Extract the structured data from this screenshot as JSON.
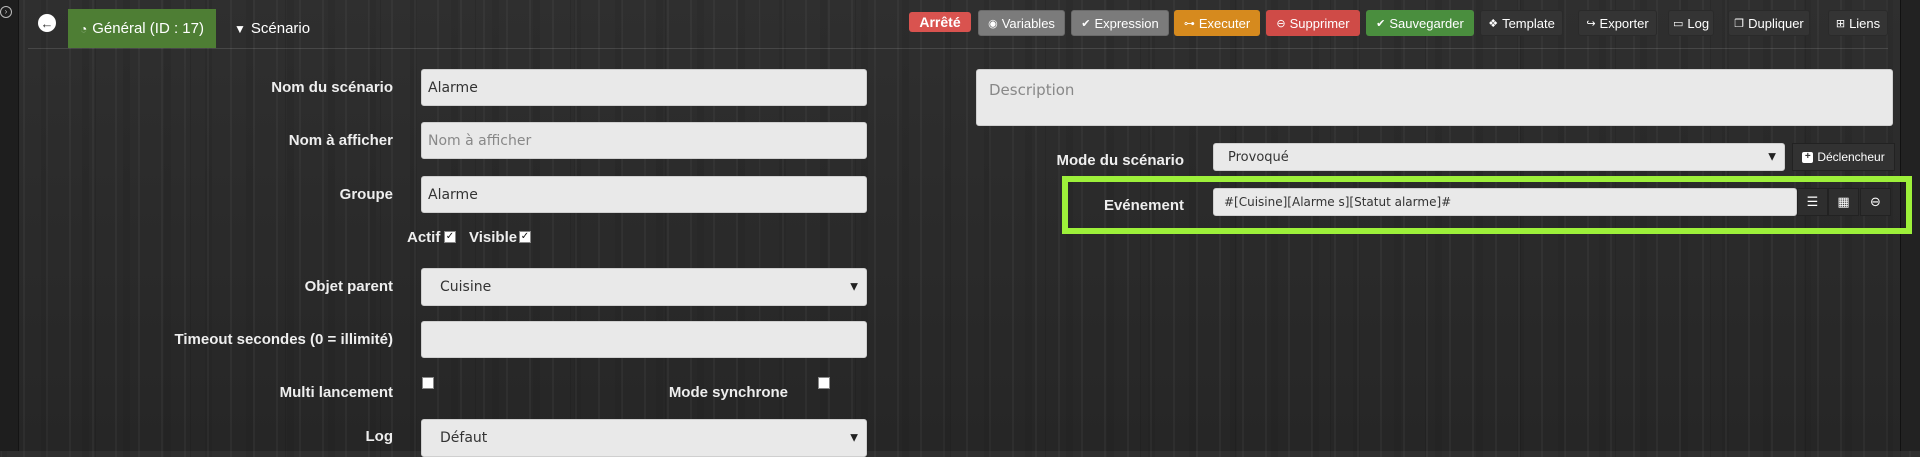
{
  "header": {
    "back_icon": "arrow-left-circle-icon",
    "tabs": [
      {
        "label": "Général (ID : 17)",
        "icon": "dashboard-icon",
        "active": true
      },
      {
        "label": "Scénario",
        "icon": "filter-icon",
        "active": false
      }
    ],
    "status_badge": "Arrêté",
    "buttons": {
      "variables": "Variables",
      "expression": "Expression",
      "executer": "Executer",
      "supprimer": "Supprimer",
      "sauvegarder": "Sauvegarder",
      "template": "Template",
      "exporter": "Exporter",
      "log": "Log",
      "dupliquer": "Dupliquer",
      "liens": "Liens"
    }
  },
  "form": {
    "nom_label": "Nom du scénario",
    "nom_value": "Alarme",
    "afficher_label": "Nom à afficher",
    "afficher_placeholder": "Nom à afficher",
    "groupe_label": "Groupe",
    "groupe_value": "Alarme",
    "actif_label": "Actif",
    "visible_label": "Visible",
    "parent_label": "Objet parent",
    "parent_value": "Cuisine",
    "timeout_label": "Timeout secondes (0 = illimité)",
    "timeout_value": "",
    "multi_label": "Multi lancement",
    "sync_label": "Mode synchrone",
    "log_label": "Log",
    "log_value": "Défaut",
    "description_placeholder": "Description",
    "mode_label": "Mode du scénario",
    "mode_value": "Provoqué",
    "add_trigger": "Déclencheur",
    "event_label": "Evénement",
    "event_value": "#[Cuisine][Alarme s][Statut alarme]#"
  },
  "colors": {
    "accent_green": "#4e7e34",
    "highlight": "#9df03a",
    "status_red": "#d9534f"
  }
}
